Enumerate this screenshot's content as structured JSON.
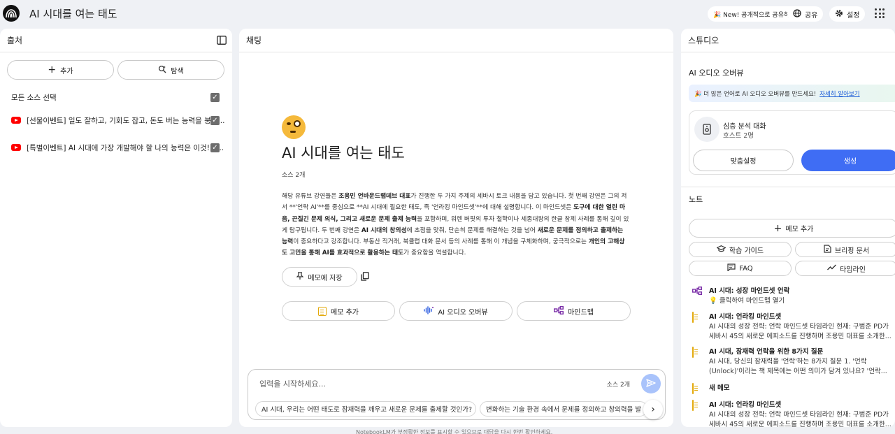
{
  "app": {
    "title": "AI 시대를 여는 태도",
    "new_badge": "🎉 New! 공개적으로 공유하기",
    "share_label": "공유",
    "settings_label": "설정"
  },
  "sources": {
    "header": "출처",
    "add_label": "추가",
    "explore_label": "탐색",
    "select_all": "모든 소스 선택",
    "items": [
      {
        "title": "[선물이벤트] 일도 잘하고, 기회도 잡고, 돈도 버는 능력을 붕인..."
      },
      {
        "title": "[특별이벤트] AI 시대에 가장 개발해야 할 나의 능력은 이것! | ..."
      }
    ]
  },
  "chat": {
    "header": "채팅",
    "notebook_title": "AI 시대를 여는 태도",
    "source_count": "소스 2개",
    "summary_parts": [
      {
        "t": "해당 유튜브 강연들은 ",
        "b": false
      },
      {
        "t": "조용민 언바운드랩데브 대표",
        "b": true
      },
      {
        "t": "가 진행한 두 가지 주제의 세바시 토크 내용을 담고 있습니다. 첫 번째 강연은 그의 저서 **'언락 AI'**를 중심으로 **AI 시대에 필요한 태도, 즉 '언라킹 마인드셋'**에 대해 설명합니다. 이 마인드셋은 ",
        "b": false
      },
      {
        "t": "도구에 대한 열린 마음, 끈질긴 문제 의식, 그리고 새로운 문제 출제 능력",
        "b": true
      },
      {
        "t": "을 포함하며, 워렌 버핏의 투자 철학이나 세종대왕의 한글 창제 사례를 통해 깊이 있게 탐구됩니다. 두 번째 강연은 ",
        "b": false
      },
      {
        "t": "AI 시대의 창의성",
        "b": true
      },
      {
        "t": "에 초점을 맞춰, 단순히 문제를 해결하는 것을 넘어 ",
        "b": false
      },
      {
        "t": "새로운 문제를 정의하고 출제하는 능력",
        "b": true
      },
      {
        "t": "이 중요하다고 강조합니다. 부동산 직거래, 북클럽 대화 문서 등의 사례를 통해 이 개념을 구체화하며, 궁극적으로는 ",
        "b": false
      },
      {
        "t": "개인의 고해상도 고민을 통해 AI를 효과적으로 활용하는 태도",
        "b": true
      },
      {
        "t": "가 중요함을 역설합니다.",
        "b": false
      }
    ],
    "save_memo": "메모에 저장",
    "add_note": "메모 추가",
    "audio_overview": "AI 오디오 오버뷰",
    "mindmap": "마인드맵",
    "input_placeholder": "입력을 시작하세요...",
    "input_source_count": "소스 2개",
    "suggestions": [
      "AI 시대, 우리는 어떤 태도로 잠재력을 깨우고 새로운 문제를 출제할 것인가?",
      "변화하는 기술 환경 속에서 문제를 정의하고 창의력을 발"
    ],
    "footnote": "NotebookLM가 부정확한 정보를 표시할 수 있으므로 대답을 다시 한번 확인하세요."
  },
  "studio": {
    "header": "스튜디오",
    "audio_section": "AI 오디오 오버뷰",
    "banner_text": "🎉 더 많은 언어로 AI 오디오 오버뷰를 만드세요!",
    "banner_link": "자세히 알아보기",
    "audio_title": "심층 분석 대화",
    "audio_hosts": "호스트 2명",
    "customize": "맞춤설정",
    "generate": "생성",
    "notes_section": "노트",
    "add_note": "메모 추가",
    "study_guide": "학습 가이드",
    "briefing": "브리핑 문서",
    "faq": "FAQ",
    "timeline": "타임라인",
    "notes": [
      {
        "icon": "mindmap-icon",
        "title": "AI 시대: 성장 마인드셋 언락",
        "lines": [
          "💡 클릭하여 마인드맵 열기"
        ]
      },
      {
        "icon": "document-icon",
        "title": "AI 시대: 언라킹 마인드셋",
        "lines": [
          "AI 시대의 성장 전략: 언락 마인드셋 타임라인 현재: 구범준 PD가",
          "세바시 45의 새로운 에피소드를 진행하며 조용민 대표를 소개한..."
        ]
      },
      {
        "icon": "document-icon",
        "title": "AI 시대, 잠재력 언락을 위한 8가지 질문",
        "lines": [
          "AI 시대, 당신의 잠재력을 '언락'하는 8가지 질문 1. '언락",
          "(Unlock)'이라는 책 제목에는 어떤 의미가 담겨 있나요? '언락..."
        ]
      },
      {
        "icon": "document-icon",
        "title": "새 메모",
        "lines": []
      },
      {
        "icon": "document-icon",
        "title": "AI 시대: 언라킹 마인드셋",
        "lines": [
          "AI 시대의 성장 전략: 언락 마인드셋 타임라인 현재: 구범준 PD가",
          "세바시 45의 새로운 에피소드를 진행하며 조용민 대표를 소개한..."
        ]
      }
    ]
  },
  "colors": {
    "primary": "#3f6df4",
    "send_disabled": "#a9c3fb",
    "youtube": "#ff0000",
    "note_doc": "#e3a90a",
    "mindmap": "#7b2fa8"
  }
}
